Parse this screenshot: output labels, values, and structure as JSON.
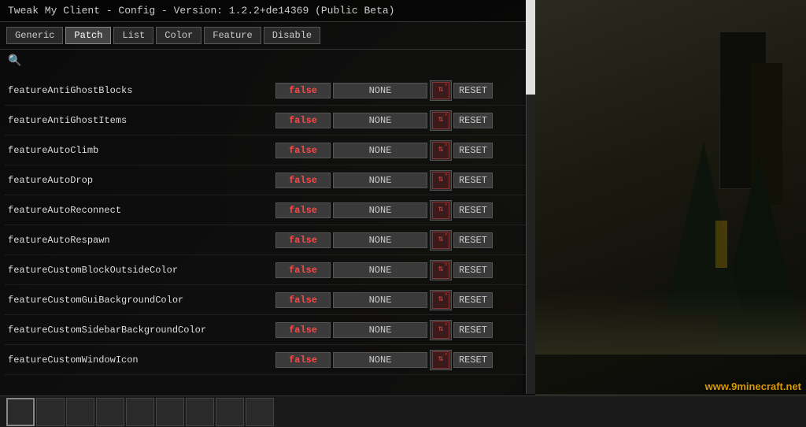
{
  "window": {
    "title": "Tweak My Client - Config - Version: 1.2.2+de14369 (Public Beta)"
  },
  "tabs": [
    {
      "label": "Generic",
      "active": false
    },
    {
      "label": "Patch",
      "active": true
    },
    {
      "label": "List",
      "active": false
    },
    {
      "label": "Color",
      "active": false
    },
    {
      "label": "Feature",
      "active": false
    },
    {
      "label": "Disable",
      "active": false
    }
  ],
  "search": {
    "icon": "🔍"
  },
  "features": [
    {
      "name": "featureAntiGhostBlocks",
      "value": "false",
      "keybind": "NONE"
    },
    {
      "name": "featureAntiGhostItems",
      "value": "false",
      "keybind": "NONE"
    },
    {
      "name": "featureAutoClimb",
      "value": "false",
      "keybind": "NONE"
    },
    {
      "name": "featureAutoDrop",
      "value": "false",
      "keybind": "NONE"
    },
    {
      "name": "featureAutoReconnect",
      "value": "false",
      "keybind": "NONE"
    },
    {
      "name": "featureAutoRespawn",
      "value": "false",
      "keybind": "NONE"
    },
    {
      "name": "featureCustomBlockOutsideColor",
      "value": "false",
      "keybind": "NONE"
    },
    {
      "name": "featureCustomGuiBackgroundColor",
      "value": "false",
      "keybind": "NONE"
    },
    {
      "name": "featureCustomSidebarBackgroundColor",
      "value": "false",
      "keybind": "NONE"
    },
    {
      "name": "featureCustomWindowIcon",
      "value": "false",
      "keybind": "NONE"
    }
  ],
  "buttons": {
    "reset_label": "RESET"
  },
  "watermark": "www.9minecraft.net",
  "taskbar": {
    "slots": [
      0,
      1,
      2,
      3,
      4,
      5,
      6,
      7,
      8
    ],
    "active_slot": 0
  }
}
